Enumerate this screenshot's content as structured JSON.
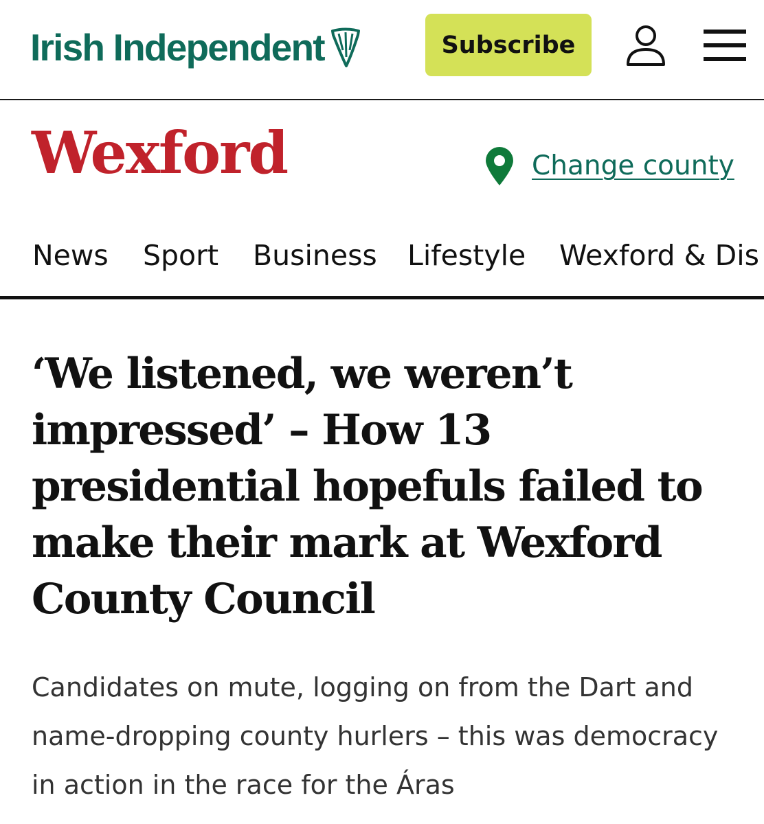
{
  "header": {
    "brand": "Irish Independent",
    "brand_color": "#0f6b5a",
    "subscribe_label": "Subscribe",
    "subscribe_color": "#d4e157",
    "icons": [
      "harp-icon",
      "account-icon",
      "menu-icon"
    ]
  },
  "section": {
    "title": "Wexford",
    "title_color": "#c0222b",
    "change_county_label": "Change county",
    "pin_icon": "map-pin-icon"
  },
  "nav": {
    "items": [
      "News",
      "Sport",
      "Business",
      "Lifestyle",
      "Wexford & Dis"
    ]
  },
  "article": {
    "headline": "‘We listened, we weren’t impressed’ – How 13 presidential hopefuls failed to make their mark at Wexford County Council",
    "standfirst": "Candidates on mute, logging on from the Dart and name-dropping county hurlers – this was democracy in action in the race for the Áras"
  }
}
